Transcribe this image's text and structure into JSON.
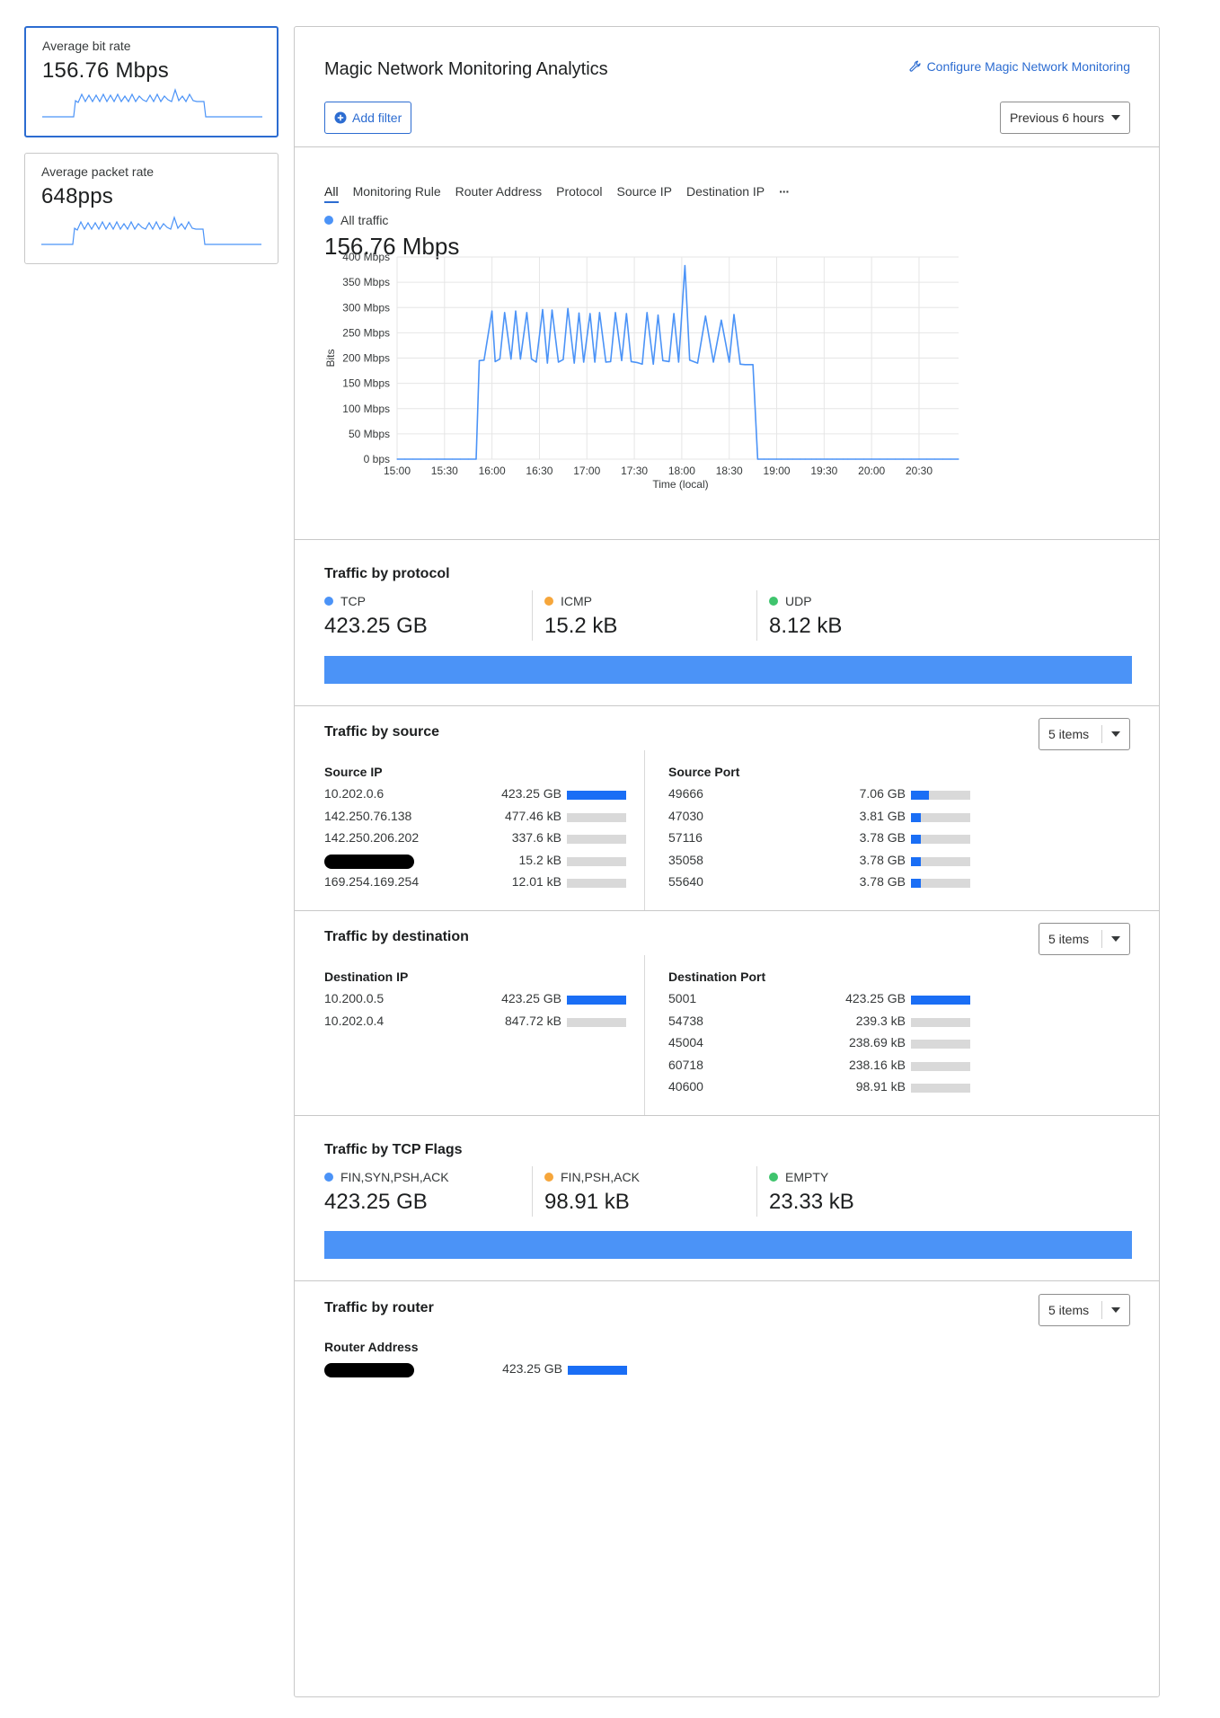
{
  "stats": [
    {
      "label": "Average bit rate",
      "value": "156.76 Mbps"
    },
    {
      "label": "Average packet rate",
      "value": "648pps"
    }
  ],
  "header": {
    "title": "Magic Network Monitoring Analytics",
    "config_link": "Configure Magic Network Monitoring",
    "add_filter": "Add filter",
    "time_range": "Previous 6 hours"
  },
  "tabs": [
    "All",
    "Monitoring Rule",
    "Router Address",
    "Protocol",
    "Source IP",
    "Destination IP"
  ],
  "tabs_more": "···",
  "series_label": "All traffic",
  "series_value": "156.76 Mbps",
  "colors": {
    "accent": "#2c6cd1",
    "line": "#4b93f7",
    "bar": "#1a6ef5",
    "tcp": "#4b93f7",
    "icmp": "#f6a63b",
    "udp": "#3fc46d"
  },
  "chart_data": {
    "type": "line",
    "xlabel": "Time (local)",
    "ylabel": "Bits",
    "y_ticks": [
      "0 bps",
      "50 Mbps",
      "100 Mbps",
      "150 Mbps",
      "200 Mbps",
      "250 Mbps",
      "300 Mbps",
      "350 Mbps",
      "400 Mbps"
    ],
    "x_ticks": [
      "15:00",
      "15:30",
      "16:00",
      "16:30",
      "17:00",
      "17:30",
      "18:00",
      "18:30",
      "19:00",
      "19:30",
      "20:00",
      "20:30"
    ],
    "ylim": [
      0,
      400
    ],
    "y_unit": "Mbps",
    "grid": true,
    "series": [
      {
        "x": [
          "15:00",
          "15:05",
          "15:10",
          "15:15",
          "15:20",
          "15:25",
          "15:30",
          "15:35",
          "15:40",
          "15:45",
          "15:50",
          "15:52",
          "15:55",
          "16:00",
          "16:02",
          "16:05",
          "16:08",
          "16:12",
          "16:15",
          "16:18",
          "16:22",
          "16:25",
          "16:28",
          "16:32",
          "16:35",
          "16:38",
          "16:42",
          "16:45",
          "16:48",
          "16:52",
          "16:55",
          "16:58",
          "17:02",
          "17:05",
          "17:08",
          "17:12",
          "17:15",
          "17:18",
          "17:22",
          "17:25",
          "17:28",
          "17:32",
          "17:35",
          "17:38",
          "17:42",
          "17:45",
          "17:48",
          "17:52",
          "17:55",
          "17:58",
          "18:02",
          "18:05",
          "18:10",
          "18:15",
          "18:20",
          "18:25",
          "18:30",
          "18:33",
          "18:37",
          "18:40",
          "18:45",
          "18:48",
          "18:52",
          "18:55",
          "19:00",
          "19:03",
          "19:07",
          "19:10",
          "19:15",
          "19:18",
          "19:22",
          "19:25",
          "19:28",
          "19:32",
          "19:35",
          "19:38",
          "19:42",
          "19:45",
          "19:50",
          "19:55",
          "20:00",
          "20:05",
          "20:10",
          "20:15",
          "20:20",
          "20:25",
          "20:30",
          "20:35",
          "20:40",
          "20:45",
          "20:50",
          "20:55"
        ],
        "y": [
          0,
          0,
          0,
          0,
          0,
          0,
          0,
          0,
          0,
          0,
          0,
          195,
          196,
          293,
          193,
          198,
          290,
          198,
          293,
          198,
          290,
          198,
          192,
          296,
          190,
          295,
          192,
          197,
          298,
          190,
          289,
          192,
          288,
          192,
          290,
          192,
          193,
          290,
          195,
          288,
          193,
          191,
          188,
          290,
          188,
          285,
          195,
          193,
          288,
          192,
          383,
          196,
          190,
          283,
          192,
          275,
          192,
          286,
          188,
          187,
          187,
          0,
          0,
          0,
          0,
          0,
          0,
          0,
          0,
          0,
          0,
          0,
          0,
          0,
          0,
          0,
          0,
          0,
          0,
          0,
          0,
          0,
          0,
          0,
          0,
          0,
          0,
          0,
          0,
          0,
          0,
          0
        ]
      }
    ]
  },
  "protocol": {
    "title": "Traffic by protocol",
    "items": [
      {
        "label": "TCP",
        "value": "423.25 GB"
      },
      {
        "label": "ICMP",
        "value": "15.2 kB"
      },
      {
        "label": "UDP",
        "value": "8.12 kB"
      }
    ]
  },
  "source": {
    "title": "Traffic by source",
    "items_select": "5 items",
    "ip_header": "Source IP",
    "port_header": "Source Port",
    "ips": [
      {
        "name": "10.202.0.6",
        "value": "423.25 GB",
        "share": 1.0
      },
      {
        "name": "142.250.76.138",
        "value": "477.46 kB",
        "share": 0
      },
      {
        "name": "142.250.206.202",
        "value": "337.6 kB",
        "share": 0
      },
      {
        "name": "",
        "value": "15.2 kB",
        "share": 0
      },
      {
        "name": "169.254.169.254",
        "value": "12.01 kB",
        "share": 0
      }
    ],
    "ports": [
      {
        "name": "49666",
        "value": "7.06 GB",
        "share": 0.3
      },
      {
        "name": "47030",
        "value": "3.81 GB",
        "share": 0.16
      },
      {
        "name": "57116",
        "value": "3.78 GB",
        "share": 0.16
      },
      {
        "name": "35058",
        "value": "3.78 GB",
        "share": 0.16
      },
      {
        "name": "55640",
        "value": "3.78 GB",
        "share": 0.16
      }
    ]
  },
  "destination": {
    "title": "Traffic by destination",
    "items_select": "5 items",
    "ip_header": "Destination IP",
    "port_header": "Destination Port",
    "ips": [
      {
        "name": "10.200.0.5",
        "value": "423.25 GB",
        "share": 1.0
      },
      {
        "name": "10.202.0.4",
        "value": "847.72 kB",
        "share": 0
      }
    ],
    "ports": [
      {
        "name": "5001",
        "value": "423.25 GB",
        "share": 1.0
      },
      {
        "name": "54738",
        "value": "239.3 kB",
        "share": 0
      },
      {
        "name": "45004",
        "value": "238.69 kB",
        "share": 0
      },
      {
        "name": "60718",
        "value": "238.16 kB",
        "share": 0
      },
      {
        "name": "40600",
        "value": "98.91 kB",
        "share": 0
      }
    ]
  },
  "tcp_flags": {
    "title": "Traffic by TCP Flags",
    "items": [
      {
        "label": "FIN,SYN,PSH,ACK",
        "value": "423.25 GB"
      },
      {
        "label": "FIN,PSH,ACK",
        "value": "98.91 kB"
      },
      {
        "label": "EMPTY",
        "value": "23.33 kB"
      }
    ]
  },
  "router": {
    "title": "Traffic by router",
    "items_select": "5 items",
    "header": "Router Address",
    "rows": [
      {
        "name": "",
        "value": "423.25 GB",
        "share": 1.0
      }
    ]
  }
}
